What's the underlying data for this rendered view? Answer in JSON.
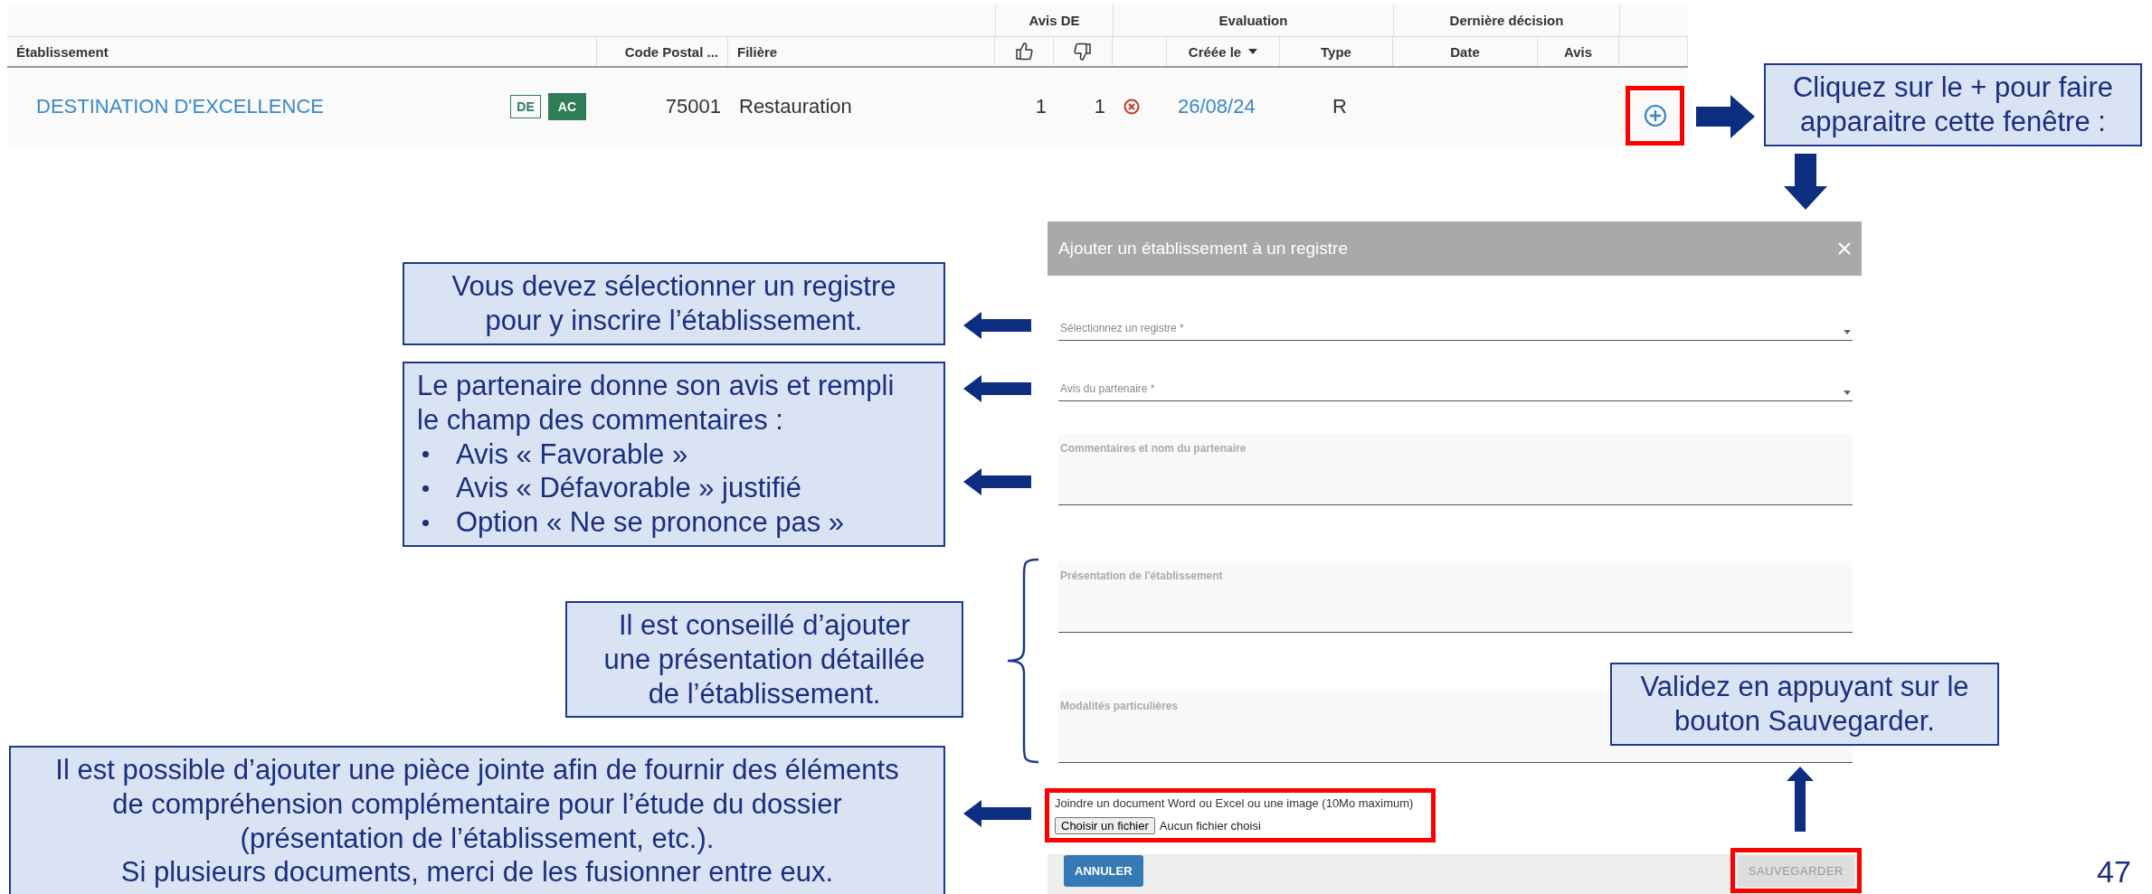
{
  "table": {
    "group_headers": [
      {
        "label": "Avis DE"
      },
      {
        "label": "Evaluation"
      },
      {
        "label": "Dernière décision"
      }
    ],
    "columns": [
      {
        "kind": "text",
        "label": "Établissement",
        "sorted": false
      },
      {
        "kind": "text",
        "label": "Code Postal ...",
        "sorted": false
      },
      {
        "kind": "text",
        "label": "Filière",
        "sorted": false
      },
      {
        "kind": "thumbs-up"
      },
      {
        "kind": "thumbs-down"
      },
      {
        "kind": "blank"
      },
      {
        "kind": "text",
        "label": "Créée le",
        "sorted": true
      },
      {
        "kind": "text",
        "label": "Type",
        "sorted": false
      },
      {
        "kind": "text",
        "label": "Date",
        "sorted": false
      },
      {
        "kind": "text",
        "label": "Avis",
        "sorted": false
      },
      {
        "kind": "blank"
      }
    ],
    "rows": [
      {
        "establishment": "DESTINATION D'EXCELLENCE",
        "badges": [
          {
            "label": "DE",
            "filled": false
          },
          {
            "label": "AC",
            "filled": true
          }
        ],
        "postal_code": "75001",
        "sector": "Restauration",
        "favorable": "1",
        "unfavorable": "1",
        "evaluation_refused": true,
        "created": "26/08/24",
        "type": "R",
        "add_highlighted": true
      }
    ]
  },
  "dialog": {
    "title": "Ajouter un établissement à un registre",
    "fields": [
      {
        "kind": "select",
        "placeholder": "Sélectionnez un registre *"
      },
      {
        "kind": "select",
        "placeholder": "Avis du partenaire *"
      },
      {
        "kind": "textarea",
        "placeholder": "Commentaires et nom du partenaire"
      },
      {
        "kind": "textarea",
        "placeholder": "Présentation de l'établissement"
      },
      {
        "kind": "textarea",
        "placeholder": "Modalités particulières"
      }
    ],
    "attachment": {
      "label": "Joindre un document Word ou Excel ou une image (10Mo maximum)",
      "button": "Choisir un fichier",
      "status": "Aucun fichier choisi",
      "highlighted": true
    },
    "buttons": [
      {
        "label": "ANNULER",
        "kind": "primary",
        "highlighted": false
      },
      {
        "label": "SAUVEGARDER",
        "kind": "disabled",
        "highlighted": true
      }
    ]
  },
  "callouts": [
    {
      "text": "Cliquez sur le + pour faire\napparaitre cette fenêtre :"
    },
    {
      "text": "Vous devez sélectionner un registre\npour y inscrire l’établissement."
    },
    {
      "text": "Le partenaire donne son avis et rempli\nle champ des commentaires :",
      "bullets": [
        "Avis « Favorable »",
        "Avis « Défavorable » justifié",
        "Option « Ne se prononce pas »"
      ]
    },
    {
      "text": "Il est conseillé d’ajouter\nune présentation détaillée\nde l’établissement."
    },
    {
      "text": "Il est possible d’ajouter une pièce jointe afin de fournir des éléments\nde compréhension complémentaire pour l’étude du dossier\n(présentation de l’établissement, etc.).\nSi plusieurs documents, merci de les fusionner entre eux."
    },
    {
      "text": "Validez en appuyant sur le\nbouton Sauvegarder."
    }
  ],
  "page_number": "47"
}
